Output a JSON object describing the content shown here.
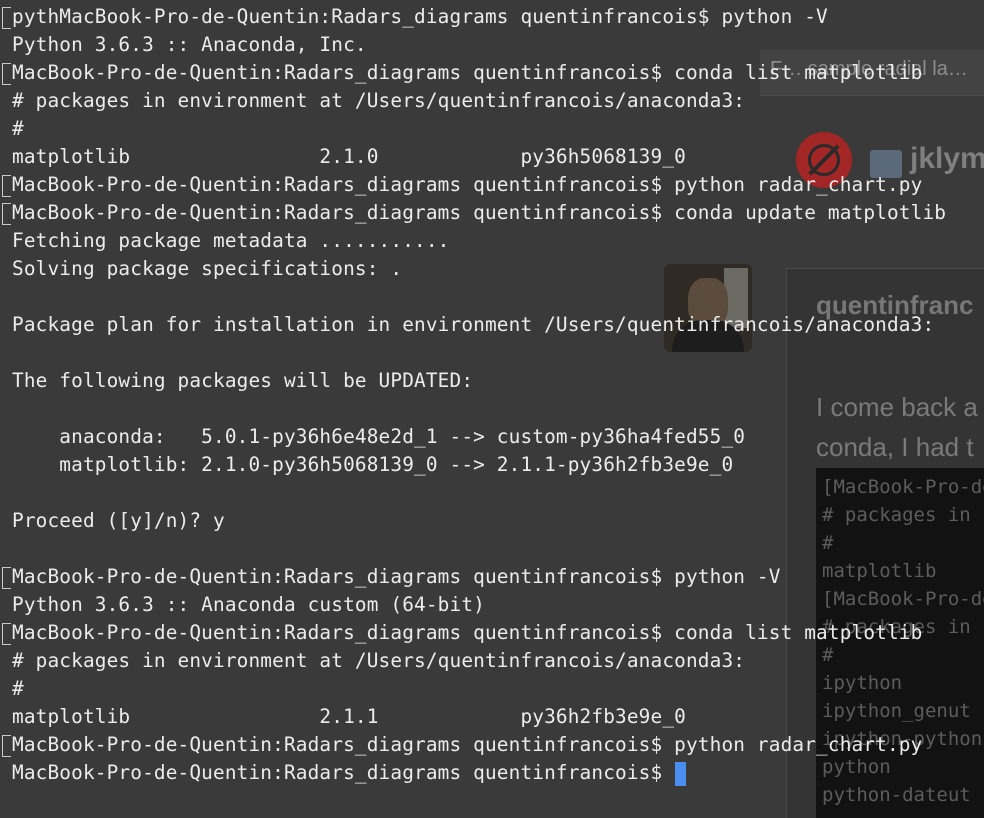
{
  "background_page": {
    "title_snippet": "F… sample radial la…",
    "username_top": "jklym",
    "card_username": "quentinfranc",
    "card_text": [
      "I come back a",
      "conda, I had t"
    ],
    "code_lines": [
      "[MacBook-Pro-de",
      "# packages in",
      "#",
      "matplotlib",
      "[MacBook-Pro-de",
      "# packages in",
      "#",
      "ipython",
      "ipython_genut",
      "ipython-python",
      "python",
      "python-dateut"
    ]
  },
  "terminal": {
    "lines": [
      "pythMacBook-Pro-de-Quentin:Radars_diagrams quentinfrancois$ python -V",
      "Python 3.6.3 :: Anaconda, Inc.",
      "MacBook-Pro-de-Quentin:Radars_diagrams quentinfrancois$ conda list matplotlib",
      "# packages in environment at /Users/quentinfrancois/anaconda3:",
      "#",
      "matplotlib                2.1.0            py36h5068139_0",
      "MacBook-Pro-de-Quentin:Radars_diagrams quentinfrancois$ python radar_chart.py",
      "MacBook-Pro-de-Quentin:Radars_diagrams quentinfrancois$ conda update matplotlib",
      "Fetching package metadata ...........",
      "Solving package specifications: .",
      "",
      "Package plan for installation in environment /Users/quentinfrancois/anaconda3:",
      "",
      "The following packages will be UPDATED:",
      "",
      "    anaconda:   5.0.1-py36h6e48e2d_1 --> custom-py36ha4fed55_0",
      "    matplotlib: 2.1.0-py36h5068139_0 --> 2.1.1-py36h2fb3e9e_0",
      "",
      "Proceed ([y]/n)? y",
      "",
      "MacBook-Pro-de-Quentin:Radars_diagrams quentinfrancois$ python -V",
      "Python 3.6.3 :: Anaconda custom (64-bit)",
      "MacBook-Pro-de-Quentin:Radars_diagrams quentinfrancois$ conda list matplotlib",
      "# packages in environment at /Users/quentinfrancois/anaconda3:",
      "#",
      "matplotlib                2.1.1            py36h2fb3e9e_0",
      "MacBook-Pro-de-Quentin:Radars_diagrams quentinfrancois$ python radar_chart.py",
      "MacBook-Pro-de-Quentin:Radars_diagrams quentinfrancois$ "
    ],
    "marked_line_indices": [
      0,
      2,
      6,
      7,
      20,
      22,
      26
    ],
    "cursor_color": "#4a8ff0",
    "text_color": "#ececec",
    "background_color": "#262626"
  }
}
